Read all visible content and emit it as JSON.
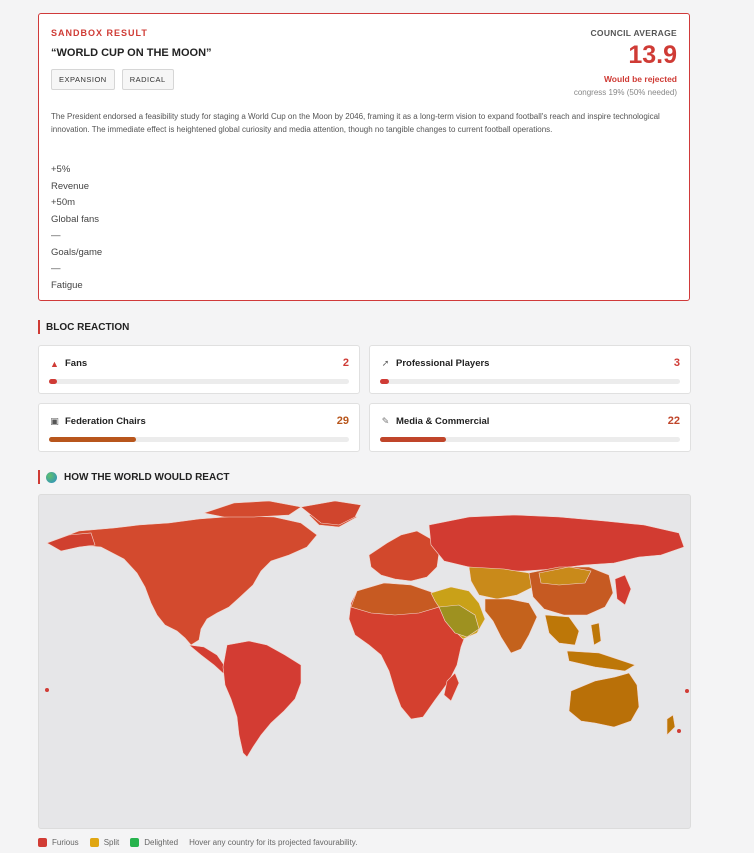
{
  "result": {
    "kicker": "SANDBOX RESULT",
    "title": "“WORLD CUP ON THE MOON”",
    "tags": [
      "EXPANSION",
      "RADICAL"
    ],
    "council_label": "COUNCIL AVERAGE",
    "council_value": "13.9",
    "verdict": "Would be rejected",
    "congress": "congress 19% (50% needed)",
    "summary": "The President endorsed a feasibility study for staging a World Cup on the Moon by 2046, framing it as a long-term vision to expand football's reach and inspire technological innovation. The immediate effect is heightened global curiosity and media attention, though no tangible changes to current football operations.",
    "stats": [
      {
        "value": "+5%",
        "label": "Revenue"
      },
      {
        "value": "+50m",
        "label": "Global fans"
      },
      {
        "value": "—",
        "label": "Goals/game"
      },
      {
        "value": "—",
        "label": "Fatigue"
      }
    ]
  },
  "bloc_title": "BLOC REACTION",
  "blocs": [
    {
      "name": "Fans",
      "score": "2",
      "level": 0.02,
      "icon": "megaphone-icon",
      "color": "#cf3b35"
    },
    {
      "name": "Professional Players",
      "score": "3",
      "level": 0.03,
      "icon": "boot-icon",
      "color": "#cf3b35"
    },
    {
      "name": "Federation Chairs",
      "score": "29",
      "level": 0.29,
      "icon": "building-icon",
      "color": "#b8561c"
    },
    {
      "name": "Media & Commercial",
      "score": "22",
      "level": 0.22,
      "icon": "microphone-icon",
      "color": "#c0452a"
    }
  ],
  "world_title": "HOW THE WORLD WOULD REACT",
  "legend": {
    "furious": "Furious",
    "split": "Split",
    "delighted": "Delighted",
    "hint": "Hover any country for its projected favourability."
  },
  "colors": {
    "furious": "#d13c35",
    "split": "#e0a612",
    "delighted": "#27b34d",
    "orange": "#c4621c",
    "amber": "#bd7708",
    "olive": "#9e9120",
    "accent": "#cf3b35"
  }
}
